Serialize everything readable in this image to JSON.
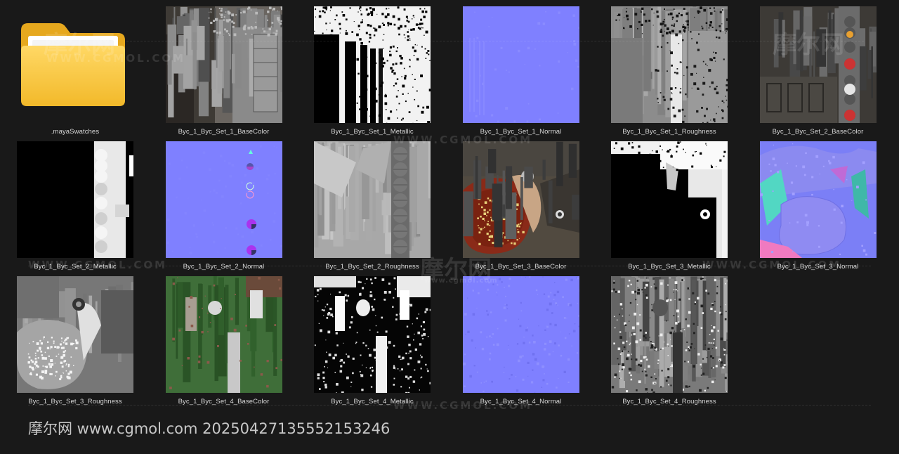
{
  "files": [
    {
      "label": ".mayaSwatches",
      "kind": "folder",
      "icon": "folder-icon"
    },
    {
      "label": "Byc_1_Byc_Set_1_BaseColor",
      "kind": "basecolor"
    },
    {
      "label": "Byc_1_Byc_Set_1_Metallic",
      "kind": "metallic"
    },
    {
      "label": "Byc_1_Byc_Set_1_Normal",
      "kind": "normal"
    },
    {
      "label": "Byc_1_Byc_Set_1_Roughness",
      "kind": "roughness"
    },
    {
      "label": "Byc_1_Byc_Set_2_BaseColor",
      "kind": "basecolor2"
    },
    {
      "label": "Byc_1_Byc_Set_2_Metallic",
      "kind": "metallic2"
    },
    {
      "label": "Byc_1_Byc_Set_2_Normal",
      "kind": "normal2"
    },
    {
      "label": "Byc_1_Byc_Set_2_Roughness",
      "kind": "roughness2"
    },
    {
      "label": "Byc_1_Byc_Set_3_BaseColor",
      "kind": "basecolor3"
    },
    {
      "label": "Byc_1_Byc_Set_3_Metallic",
      "kind": "metallic3"
    },
    {
      "label": "Byc_1_Byc_Set_3_Normal",
      "kind": "normal3"
    },
    {
      "label": "Byc_1_Byc_Set_3_Roughness",
      "kind": "roughness3"
    },
    {
      "label": "Byc_1_Byc_Set_4_BaseColor",
      "kind": "basecolor4"
    },
    {
      "label": "Byc_1_Byc_Set_4_Metallic",
      "kind": "metallic4"
    },
    {
      "label": "Byc_1_Byc_Set_4_Normal",
      "kind": "normal4"
    },
    {
      "label": "Byc_1_Byc_Set_4_Roughness",
      "kind": "roughness4"
    }
  ],
  "watermarks": {
    "brand": "摩尔网",
    "url": "WWW.CGMOL.COM",
    "small_url": "www.cgmol.com"
  },
  "footer": {
    "text": "摩尔网 www.cgmol.com 20250427135552153246"
  },
  "colors": {
    "background": "#191919",
    "label": "#d8d8d8",
    "normal_map": "#7f80ff",
    "folder": "#f7c94b"
  }
}
